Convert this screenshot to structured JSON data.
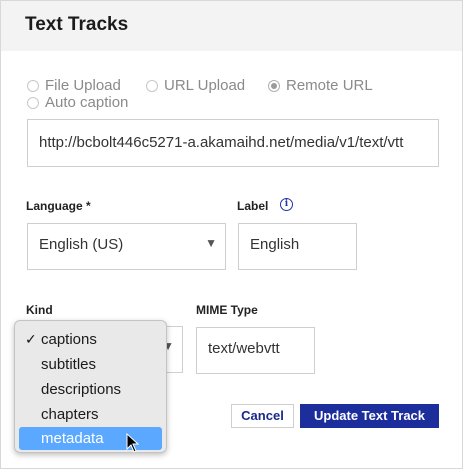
{
  "dialog": {
    "title": "Text Tracks"
  },
  "source_options": [
    {
      "label": "File Upload",
      "checked": false
    },
    {
      "label": "URL Upload",
      "checked": false
    },
    {
      "label": "Remote URL",
      "checked": true
    },
    {
      "label": "Auto caption",
      "checked": false
    }
  ],
  "url_field": {
    "value": "http://bcbolt446c5271-a.akamaihd.net/media/v1/text/vtt"
  },
  "language": {
    "label": "Language *",
    "value": "English (US)"
  },
  "track_label": {
    "label": "Label",
    "value": "English"
  },
  "kind": {
    "label": "Kind",
    "options": [
      "captions",
      "subtitles",
      "descriptions",
      "chapters",
      "metadata"
    ],
    "checked": "captions",
    "highlighted": "metadata"
  },
  "mime": {
    "label": "MIME Type",
    "value": "text/webvtt"
  },
  "actions": {
    "cancel": "Cancel",
    "update": "Update Text Track"
  },
  "icons": {
    "info": "info-icon",
    "select_arrow": "chevron-down-icon",
    "cursor": "mouse-pointer-icon"
  },
  "colors": {
    "primary": "#1c2d9c",
    "highlight": "#5aa8ff",
    "header_bg": "#f3f3f3"
  }
}
